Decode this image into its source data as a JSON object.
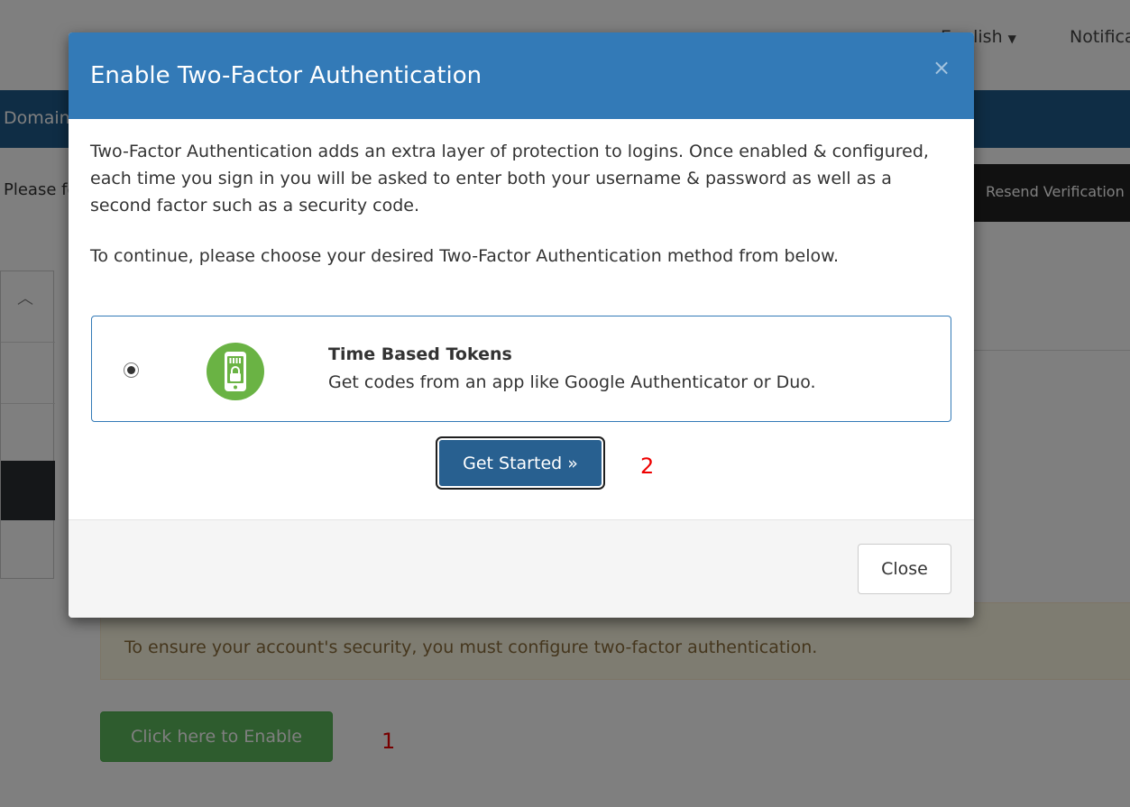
{
  "header": {
    "language": "English",
    "notifications": "Notifications"
  },
  "nav": {
    "domains": "Domains"
  },
  "notice": {
    "follow_text": "Please follow",
    "resend_button": "Resend Verification Email"
  },
  "security": {
    "alert": "To ensure your account's security, you must configure two-factor authentication.",
    "enable_button": "Click here to Enable",
    "annotation_1": "1"
  },
  "modal": {
    "title": "Enable Two-Factor Authentication",
    "close_x": "×",
    "intro": "Two-Factor Authentication adds an extra layer of protection to logins. Once enabled & configured, each time you sign in you will be asked to enter both your username & password as well as a second factor such as a security code.",
    "choose": "To continue, please choose your desired Two-Factor Authentication method from below.",
    "method": {
      "title": "Time Based Tokens",
      "description": "Get codes from an app like Google Authenticator or Duo.",
      "icon": "phone-lock-icon",
      "selected": true
    },
    "get_started": "Get Started »",
    "annotation_2": "2",
    "close_button": "Close"
  },
  "colors": {
    "modal_header": "#337ab7",
    "primary_button": "#286090",
    "success_button": "#5cb85c",
    "nav_bar": "#1e5a8a",
    "annotation": "#ee0000",
    "icon_green": "#6ab344"
  }
}
